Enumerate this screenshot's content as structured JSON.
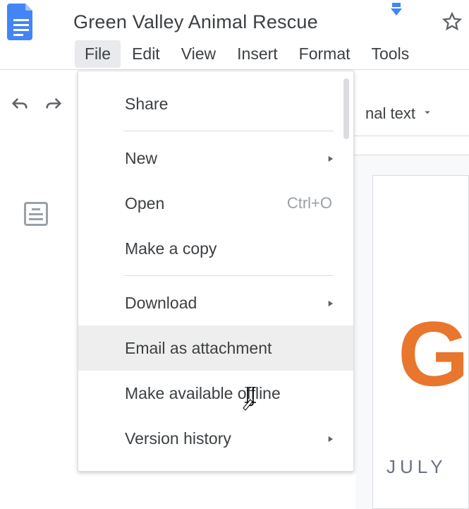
{
  "header": {
    "doc_title": "Green Valley Animal Rescue"
  },
  "menubar": {
    "file": "File",
    "edit": "Edit",
    "view": "View",
    "insert": "Insert",
    "format": "Format",
    "tools": "Tools"
  },
  "toolbar": {
    "style_label": "nal text"
  },
  "file_menu": {
    "share": "Share",
    "new": "New",
    "open": "Open",
    "open_shortcut": "Ctrl+O",
    "make_copy": "Make a copy",
    "download": "Download",
    "email_attachment": "Email as attachment",
    "make_offline": "Make available offline",
    "version_history": "Version history"
  },
  "page_preview": {
    "big_letter": "G",
    "subtitle": "JULY"
  }
}
